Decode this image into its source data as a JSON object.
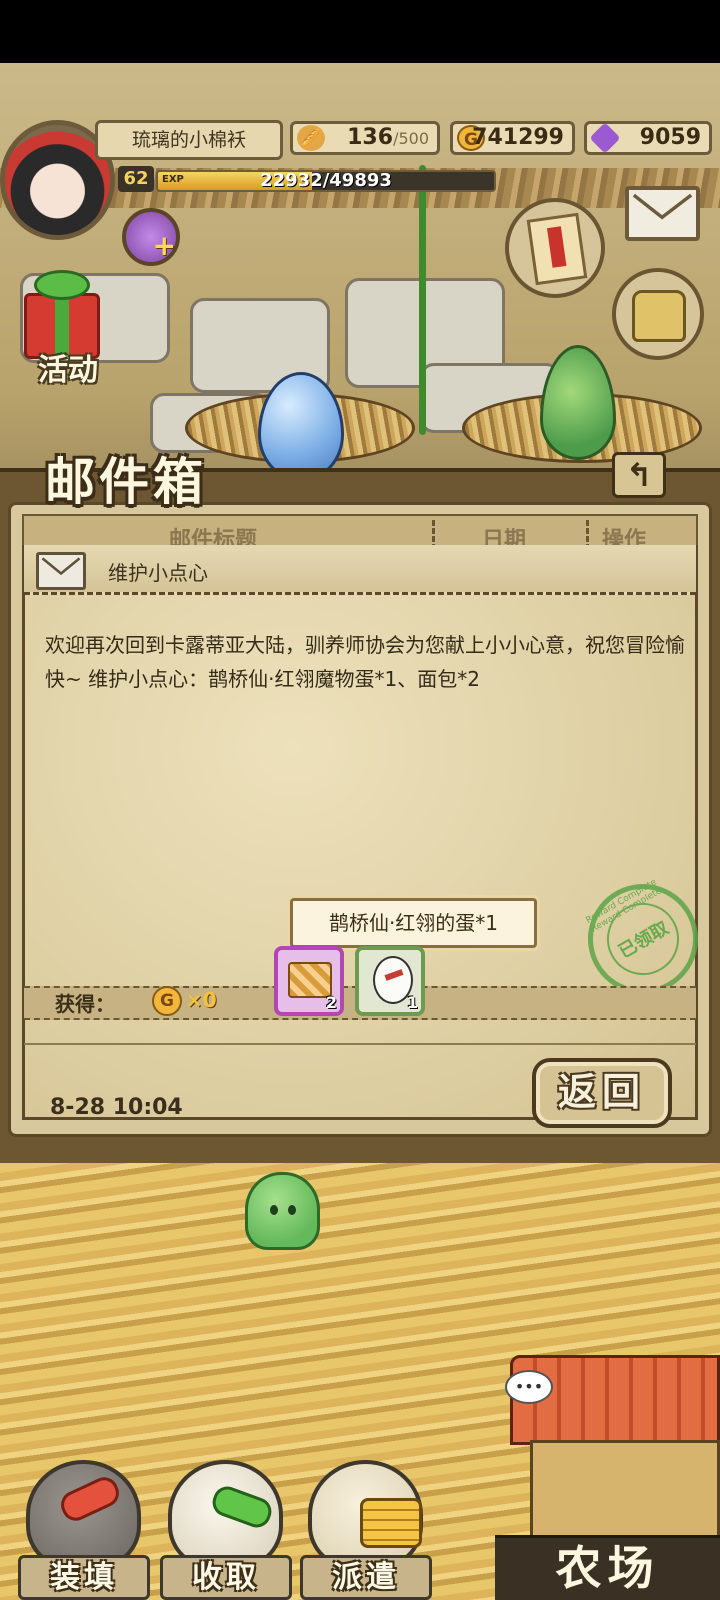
{
  "player": {
    "name": "琉璃的小棉袄",
    "level": "62",
    "exp_tag": "EXP",
    "exp_text": "22932/49893",
    "exp_fraction": 0.4596
  },
  "resources": {
    "bread_current": "136",
    "bread_max": "/500",
    "gold": "741299",
    "gems": "9059"
  },
  "icons": {
    "bread": "bread-icon",
    "gold": "G",
    "gem": "gem-icon",
    "gem_plus": "+"
  },
  "side_menu": {
    "activity_label": "活动"
  },
  "mailbox": {
    "title": "邮件箱",
    "back_icon": "↰",
    "columns": {
      "title": "邮件标题",
      "date": "日期",
      "action": "操作"
    },
    "mail": {
      "subject": "维护小点心",
      "body": "欢迎再次回到卡露蒂亚大陆，驯养师协会为您献上小小心意，祝您冒险愉快~ 维护小点心：鹊桥仙·红翎魔物蛋*1、面包*2",
      "tooltip": "鹊桥仙·红翎的蛋*1",
      "stamp_text": "已领取",
      "stamp_ring": "Reward Complete Reward Complete",
      "rewards_label": "获得：",
      "coin_icon": "G",
      "coin_amount": "×0",
      "items": [
        {
          "name": "bread",
          "qty": "2"
        },
        {
          "name": "egg",
          "qty": "1"
        }
      ],
      "date": "8-28 10:04",
      "return_label": "返回"
    }
  },
  "bottom_nav": {
    "load": "装填",
    "collect": "收取",
    "dispatch": "派遣",
    "farm": "农场",
    "chat": "•••"
  },
  "colors": {
    "panel_border": "#6d5733",
    "paper": "#dccda0",
    "stamp_green": "#5da447",
    "item_purple": "#b345b7",
    "item_green": "#6c9a50"
  }
}
